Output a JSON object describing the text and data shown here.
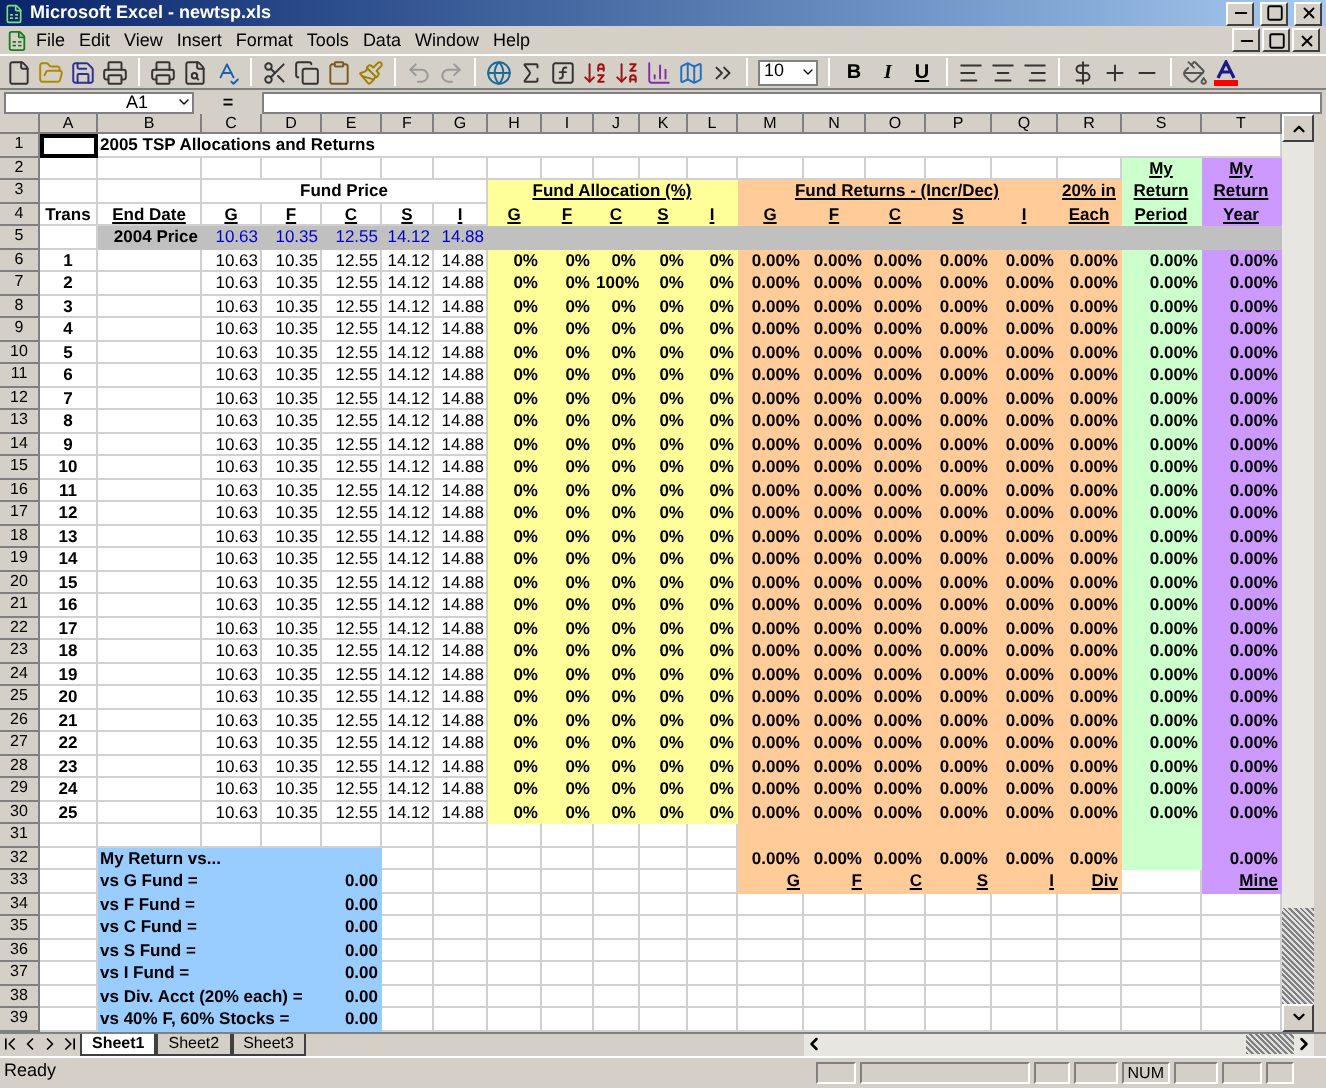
{
  "window": {
    "title": "Microsoft Excel - newtsp.xls"
  },
  "menu": [
    "File",
    "Edit",
    "View",
    "Insert",
    "Format",
    "Tools",
    "Data",
    "Window",
    "Help"
  ],
  "toolbar": {
    "font_size": "10",
    "format_buttons": [
      "B",
      "I",
      "U"
    ]
  },
  "formula_bar": {
    "name_box": "A1",
    "equals": "="
  },
  "columns": [
    "A",
    "B",
    "C",
    "D",
    "E",
    "F",
    "G",
    "H",
    "I",
    "J",
    "K",
    "L",
    "M",
    "N",
    "O",
    "P",
    "Q",
    "R",
    "S",
    "T"
  ],
  "rows": [
    {
      "number": "1",
      "cells": [
        null,
        "2005 TSP Allocations and Returns",
        null,
        null,
        null,
        null,
        null,
        null,
        null,
        null,
        null,
        null,
        null,
        null,
        null,
        null,
        null,
        null,
        null,
        null
      ]
    },
    {
      "number": "2",
      "cells": [
        null,
        null,
        null,
        null,
        null,
        null,
        null,
        null,
        null,
        null,
        null,
        null,
        null,
        null,
        null,
        null,
        null,
        null,
        "My",
        "My"
      ]
    },
    {
      "number": "3",
      "cells": [
        null,
        null,
        "Fund Price",
        null,
        null,
        null,
        null,
        "Fund Allocation (%)",
        null,
        null,
        null,
        null,
        "Fund Returns - (Incr/Dec)",
        null,
        null,
        null,
        null,
        "20% in",
        "Return",
        "Return"
      ]
    },
    {
      "number": "4",
      "cells": [
        "Trans",
        "End Date",
        "G",
        "F",
        "C",
        "S",
        "I",
        "G",
        "F",
        "C",
        "S",
        "I",
        "G",
        "F",
        "C",
        "S",
        "I",
        "Each",
        "Period",
        "Year"
      ]
    },
    {
      "number": "5",
      "cells": [
        null,
        "2004 Price",
        "10.63",
        "10.35",
        "12.55",
        "14.12",
        "14.88",
        null,
        null,
        null,
        null,
        null,
        null,
        null,
        null,
        null,
        null,
        null,
        null,
        null
      ]
    },
    {
      "number": "6",
      "cells": [
        "1",
        null,
        "10.63",
        "10.35",
        "12.55",
        "14.12",
        "14.88",
        "0%",
        "0%",
        "0%",
        "0%",
        "0%",
        "0.00%",
        "0.00%",
        "0.00%",
        "0.00%",
        "0.00%",
        "0.00%",
        "0.00%",
        "0.00%"
      ]
    },
    {
      "number": "7",
      "cells": [
        "2",
        null,
        "10.63",
        "10.35",
        "12.55",
        "14.12",
        "14.88",
        "0%",
        "0%",
        "100%",
        "0%",
        "0%",
        "0.00%",
        "0.00%",
        "0.00%",
        "0.00%",
        "0.00%",
        "0.00%",
        "0.00%",
        "0.00%"
      ]
    },
    {
      "number": "8",
      "cells": [
        "3",
        null,
        "10.63",
        "10.35",
        "12.55",
        "14.12",
        "14.88",
        "0%",
        "0%",
        "0%",
        "0%",
        "0%",
        "0.00%",
        "0.00%",
        "0.00%",
        "0.00%",
        "0.00%",
        "0.00%",
        "0.00%",
        "0.00%"
      ]
    },
    {
      "number": "9",
      "cells": [
        "4",
        null,
        "10.63",
        "10.35",
        "12.55",
        "14.12",
        "14.88",
        "0%",
        "0%",
        "0%",
        "0%",
        "0%",
        "0.00%",
        "0.00%",
        "0.00%",
        "0.00%",
        "0.00%",
        "0.00%",
        "0.00%",
        "0.00%"
      ]
    },
    {
      "number": "10",
      "cells": [
        "5",
        null,
        "10.63",
        "10.35",
        "12.55",
        "14.12",
        "14.88",
        "0%",
        "0%",
        "0%",
        "0%",
        "0%",
        "0.00%",
        "0.00%",
        "0.00%",
        "0.00%",
        "0.00%",
        "0.00%",
        "0.00%",
        "0.00%"
      ]
    },
    {
      "number": "11",
      "cells": [
        "6",
        null,
        "10.63",
        "10.35",
        "12.55",
        "14.12",
        "14.88",
        "0%",
        "0%",
        "0%",
        "0%",
        "0%",
        "0.00%",
        "0.00%",
        "0.00%",
        "0.00%",
        "0.00%",
        "0.00%",
        "0.00%",
        "0.00%"
      ]
    },
    {
      "number": "12",
      "cells": [
        "7",
        null,
        "10.63",
        "10.35",
        "12.55",
        "14.12",
        "14.88",
        "0%",
        "0%",
        "0%",
        "0%",
        "0%",
        "0.00%",
        "0.00%",
        "0.00%",
        "0.00%",
        "0.00%",
        "0.00%",
        "0.00%",
        "0.00%"
      ]
    },
    {
      "number": "13",
      "cells": [
        "8",
        null,
        "10.63",
        "10.35",
        "12.55",
        "14.12",
        "14.88",
        "0%",
        "0%",
        "0%",
        "0%",
        "0%",
        "0.00%",
        "0.00%",
        "0.00%",
        "0.00%",
        "0.00%",
        "0.00%",
        "0.00%",
        "0.00%"
      ]
    },
    {
      "number": "14",
      "cells": [
        "9",
        null,
        "10.63",
        "10.35",
        "12.55",
        "14.12",
        "14.88",
        "0%",
        "0%",
        "0%",
        "0%",
        "0%",
        "0.00%",
        "0.00%",
        "0.00%",
        "0.00%",
        "0.00%",
        "0.00%",
        "0.00%",
        "0.00%"
      ]
    },
    {
      "number": "15",
      "cells": [
        "10",
        null,
        "10.63",
        "10.35",
        "12.55",
        "14.12",
        "14.88",
        "0%",
        "0%",
        "0%",
        "0%",
        "0%",
        "0.00%",
        "0.00%",
        "0.00%",
        "0.00%",
        "0.00%",
        "0.00%",
        "0.00%",
        "0.00%"
      ]
    },
    {
      "number": "16",
      "cells": [
        "11",
        null,
        "10.63",
        "10.35",
        "12.55",
        "14.12",
        "14.88",
        "0%",
        "0%",
        "0%",
        "0%",
        "0%",
        "0.00%",
        "0.00%",
        "0.00%",
        "0.00%",
        "0.00%",
        "0.00%",
        "0.00%",
        "0.00%"
      ]
    },
    {
      "number": "17",
      "cells": [
        "12",
        null,
        "10.63",
        "10.35",
        "12.55",
        "14.12",
        "14.88",
        "0%",
        "0%",
        "0%",
        "0%",
        "0%",
        "0.00%",
        "0.00%",
        "0.00%",
        "0.00%",
        "0.00%",
        "0.00%",
        "0.00%",
        "0.00%"
      ]
    },
    {
      "number": "18",
      "cells": [
        "13",
        null,
        "10.63",
        "10.35",
        "12.55",
        "14.12",
        "14.88",
        "0%",
        "0%",
        "0%",
        "0%",
        "0%",
        "0.00%",
        "0.00%",
        "0.00%",
        "0.00%",
        "0.00%",
        "0.00%",
        "0.00%",
        "0.00%"
      ]
    },
    {
      "number": "19",
      "cells": [
        "14",
        null,
        "10.63",
        "10.35",
        "12.55",
        "14.12",
        "14.88",
        "0%",
        "0%",
        "0%",
        "0%",
        "0%",
        "0.00%",
        "0.00%",
        "0.00%",
        "0.00%",
        "0.00%",
        "0.00%",
        "0.00%",
        "0.00%"
      ]
    },
    {
      "number": "20",
      "cells": [
        "15",
        null,
        "10.63",
        "10.35",
        "12.55",
        "14.12",
        "14.88",
        "0%",
        "0%",
        "0%",
        "0%",
        "0%",
        "0.00%",
        "0.00%",
        "0.00%",
        "0.00%",
        "0.00%",
        "0.00%",
        "0.00%",
        "0.00%"
      ]
    },
    {
      "number": "21",
      "cells": [
        "16",
        null,
        "10.63",
        "10.35",
        "12.55",
        "14.12",
        "14.88",
        "0%",
        "0%",
        "0%",
        "0%",
        "0%",
        "0.00%",
        "0.00%",
        "0.00%",
        "0.00%",
        "0.00%",
        "0.00%",
        "0.00%",
        "0.00%"
      ]
    },
    {
      "number": "22",
      "cells": [
        "17",
        null,
        "10.63",
        "10.35",
        "12.55",
        "14.12",
        "14.88",
        "0%",
        "0%",
        "0%",
        "0%",
        "0%",
        "0.00%",
        "0.00%",
        "0.00%",
        "0.00%",
        "0.00%",
        "0.00%",
        "0.00%",
        "0.00%"
      ]
    },
    {
      "number": "23",
      "cells": [
        "18",
        null,
        "10.63",
        "10.35",
        "12.55",
        "14.12",
        "14.88",
        "0%",
        "0%",
        "0%",
        "0%",
        "0%",
        "0.00%",
        "0.00%",
        "0.00%",
        "0.00%",
        "0.00%",
        "0.00%",
        "0.00%",
        "0.00%"
      ]
    },
    {
      "number": "24",
      "cells": [
        "19",
        null,
        "10.63",
        "10.35",
        "12.55",
        "14.12",
        "14.88",
        "0%",
        "0%",
        "0%",
        "0%",
        "0%",
        "0.00%",
        "0.00%",
        "0.00%",
        "0.00%",
        "0.00%",
        "0.00%",
        "0.00%",
        "0.00%"
      ]
    },
    {
      "number": "25",
      "cells": [
        "20",
        null,
        "10.63",
        "10.35",
        "12.55",
        "14.12",
        "14.88",
        "0%",
        "0%",
        "0%",
        "0%",
        "0%",
        "0.00%",
        "0.00%",
        "0.00%",
        "0.00%",
        "0.00%",
        "0.00%",
        "0.00%",
        "0.00%"
      ]
    },
    {
      "number": "26",
      "cells": [
        "21",
        null,
        "10.63",
        "10.35",
        "12.55",
        "14.12",
        "14.88",
        "0%",
        "0%",
        "0%",
        "0%",
        "0%",
        "0.00%",
        "0.00%",
        "0.00%",
        "0.00%",
        "0.00%",
        "0.00%",
        "0.00%",
        "0.00%"
      ]
    },
    {
      "number": "27",
      "cells": [
        "22",
        null,
        "10.63",
        "10.35",
        "12.55",
        "14.12",
        "14.88",
        "0%",
        "0%",
        "0%",
        "0%",
        "0%",
        "0.00%",
        "0.00%",
        "0.00%",
        "0.00%",
        "0.00%",
        "0.00%",
        "0.00%",
        "0.00%"
      ]
    },
    {
      "number": "28",
      "cells": [
        "23",
        null,
        "10.63",
        "10.35",
        "12.55",
        "14.12",
        "14.88",
        "0%",
        "0%",
        "0%",
        "0%",
        "0%",
        "0.00%",
        "0.00%",
        "0.00%",
        "0.00%",
        "0.00%",
        "0.00%",
        "0.00%",
        "0.00%"
      ]
    },
    {
      "number": "29",
      "cells": [
        "24",
        null,
        "10.63",
        "10.35",
        "12.55",
        "14.12",
        "14.88",
        "0%",
        "0%",
        "0%",
        "0%",
        "0%",
        "0.00%",
        "0.00%",
        "0.00%",
        "0.00%",
        "0.00%",
        "0.00%",
        "0.00%",
        "0.00%"
      ]
    },
    {
      "number": "30",
      "cells": [
        "25",
        null,
        "10.63",
        "10.35",
        "12.55",
        "14.12",
        "14.88",
        "0%",
        "0%",
        "0%",
        "0%",
        "0%",
        "0.00%",
        "0.00%",
        "0.00%",
        "0.00%",
        "0.00%",
        "0.00%",
        "0.00%",
        "0.00%"
      ]
    },
    {
      "number": "31",
      "cells": [
        null,
        null,
        null,
        null,
        null,
        null,
        null,
        null,
        null,
        null,
        null,
        null,
        null,
        null,
        null,
        null,
        null,
        null,
        null,
        null
      ]
    },
    {
      "number": "32",
      "cells": [
        null,
        "My Return vs...",
        null,
        null,
        null,
        null,
        null,
        null,
        null,
        null,
        null,
        null,
        "0.00%",
        "0.00%",
        "0.00%",
        "0.00%",
        "0.00%",
        "0.00%",
        null,
        "0.00%"
      ]
    },
    {
      "number": "33",
      "cells": [
        null,
        "vs G Fund =",
        null,
        null,
        "0.00",
        null,
        null,
        null,
        null,
        null,
        null,
        null,
        "G",
        "F",
        "C",
        "S",
        "I",
        "Div",
        null,
        "Mine"
      ]
    },
    {
      "number": "34",
      "cells": [
        null,
        "vs F Fund =",
        null,
        null,
        "0.00",
        null,
        null,
        null,
        null,
        null,
        null,
        null,
        null,
        null,
        null,
        null,
        null,
        null,
        null,
        null
      ]
    },
    {
      "number": "35",
      "cells": [
        null,
        "vs C Fund =",
        null,
        null,
        "0.00",
        null,
        null,
        null,
        null,
        null,
        null,
        null,
        null,
        null,
        null,
        null,
        null,
        null,
        null,
        null
      ]
    },
    {
      "number": "36",
      "cells": [
        null,
        "vs S Fund =",
        null,
        null,
        "0.00",
        null,
        null,
        null,
        null,
        null,
        null,
        null,
        null,
        null,
        null,
        null,
        null,
        null,
        null,
        null
      ]
    },
    {
      "number": "37",
      "cells": [
        null,
        "vs I Fund =",
        null,
        null,
        "0.00",
        null,
        null,
        null,
        null,
        null,
        null,
        null,
        null,
        null,
        null,
        null,
        null,
        null,
        null,
        null
      ]
    },
    {
      "number": "38",
      "cells": [
        null,
        "vs Div. Acct (20% each) =",
        null,
        null,
        "0.00",
        null,
        null,
        null,
        null,
        null,
        null,
        null,
        null,
        null,
        null,
        null,
        null,
        null,
        null,
        null
      ]
    },
    {
      "number": "39",
      "cells": [
        null,
        "vs 40% F, 60% Stocks =",
        null,
        null,
        "0.00",
        null,
        null,
        null,
        null,
        null,
        null,
        null,
        null,
        null,
        null,
        null,
        null,
        null,
        null,
        null
      ]
    }
  ],
  "sheet_tabs": [
    {
      "label": "Sheet1",
      "selected": true
    },
    {
      "label": "Sheet2",
      "selected": false
    },
    {
      "label": "Sheet3",
      "selected": false
    }
  ],
  "status_bar": {
    "mode": "Ready",
    "num": "NUM"
  }
}
